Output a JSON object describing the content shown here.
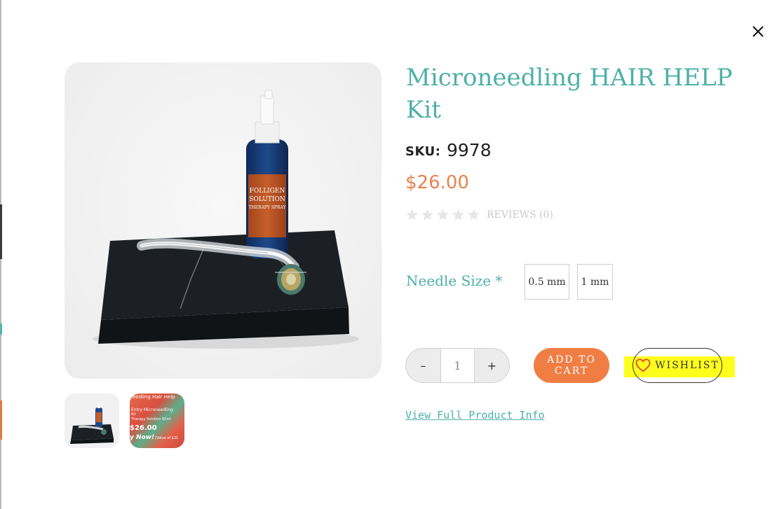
{
  "product": {
    "title": "Microneedling HAIR HELP Kit",
    "sku_label": "SKU:",
    "sku_value": "9978",
    "price": "$26.00",
    "rating": 0,
    "reviews_label": "REVIEWS (0)"
  },
  "options": {
    "label": "Needle Size *",
    "values": [
      "0.5 mm",
      "1 mm"
    ]
  },
  "quantity": {
    "minus": "–",
    "value": "1",
    "plus": "+"
  },
  "actions": {
    "add_to_cart": "ADD TO CART",
    "wishlist": "WISHLIST",
    "full_info": "View Full Product Info"
  },
  "images": {
    "bottle_brand": [
      "FOLLIGEN",
      "SOLUTION",
      "THERAPY SPRAY"
    ],
    "thumb2_lines": [
      "eedling Hair Help",
      "...",
      "Entry Microneedling",
      "Kit",
      "Therapy Solution 60ml",
      "$26.00",
      "y Now!",
      "(Value of $31"
    ]
  },
  "icons": {
    "close": "close-icon",
    "star": "star-icon",
    "heart": "heart-icon"
  },
  "colors": {
    "accent_teal": "#4db0a9",
    "price_orange": "#e8824d",
    "button_orange": "#f07e44",
    "highlight": "#ffff1e"
  }
}
